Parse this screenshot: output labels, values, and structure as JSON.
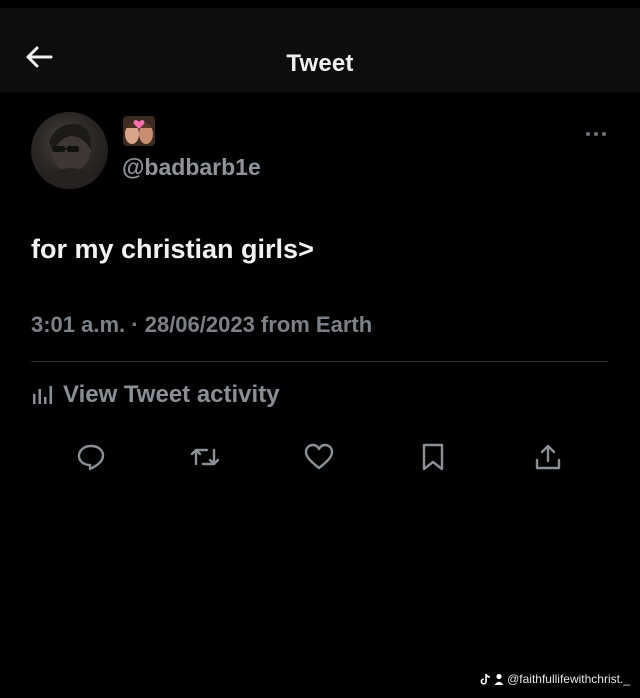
{
  "header": {
    "title": "Tweet",
    "back_icon": "arrow-left-icon"
  },
  "tweet": {
    "display_name_emoji": "couple-with-heart-emoji",
    "handle": "@badbarb1e",
    "text": "for my christian girls>",
    "timestamp": "3:01 a.m. · 28/06/2023 from Earth",
    "activity_label": "View Tweet activity"
  },
  "actions": [
    {
      "name": "reply",
      "icon": "reply-icon"
    },
    {
      "name": "retweet",
      "icon": "retweet-icon"
    },
    {
      "name": "like",
      "icon": "heart-icon"
    },
    {
      "name": "bookmark",
      "icon": "bookmark-icon"
    },
    {
      "name": "share",
      "icon": "share-icon"
    }
  ],
  "watermark": {
    "text": "@faithfullifewithchrist._",
    "icons": [
      "tiktok-icon",
      "user-icon"
    ]
  },
  "colors": {
    "background": "#000000",
    "header_background": "#0d0d0d",
    "primary_text": "#e7e9ea",
    "secondary_text": "#7c8187",
    "icon": "#8b9096"
  }
}
